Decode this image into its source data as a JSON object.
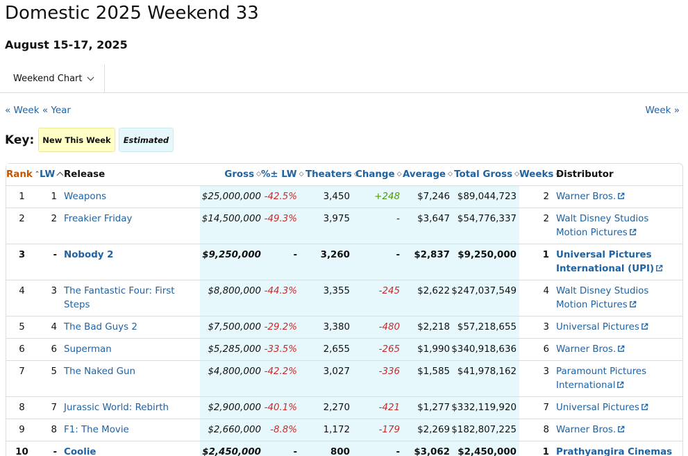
{
  "header": {
    "title": "Domestic 2025 Weekend 33",
    "subtitle": "August 15-17, 2025"
  },
  "view_select": {
    "label": "Weekend Chart"
  },
  "nav": {
    "prev_week": "« Week",
    "prev_year": "« Year",
    "next_week": "Week »"
  },
  "key": {
    "label": "Key:",
    "new_label": "New This Week",
    "estimated_label": "Estimated"
  },
  "columns": [
    "Rank",
    "LW",
    "Release",
    "Gross",
    "%± LW",
    "Theaters",
    "Change",
    "Average",
    "Total Gross",
    "Weeks",
    "Distributor"
  ],
  "rows": [
    {
      "rank": "1",
      "lw": "1",
      "release": "Weapons",
      "gross": "$25,000,000",
      "pct": "-42.5%",
      "theaters": "3,450",
      "change": "+248",
      "average": "$7,246",
      "total": "$89,044,723",
      "weeks": "2",
      "distributor": "Warner Bros.",
      "new": false
    },
    {
      "rank": "2",
      "lw": "2",
      "release": "Freakier Friday",
      "gross": "$14,500,000",
      "pct": "-49.3%",
      "theaters": "3,975",
      "change": "-",
      "average": "$3,647",
      "total": "$54,776,337",
      "weeks": "2",
      "distributor": "Walt Disney Studios Motion Pictures",
      "new": false
    },
    {
      "rank": "3",
      "lw": "-",
      "release": "Nobody 2",
      "gross": "$9,250,000",
      "pct": "-",
      "theaters": "3,260",
      "change": "-",
      "average": "$2,837",
      "total": "$9,250,000",
      "weeks": "1",
      "distributor": "Universal Pictures International (UPI)",
      "new": true
    },
    {
      "rank": "4",
      "lw": "3",
      "release": "The Fantastic Four: First Steps",
      "gross": "$8,800,000",
      "pct": "-44.3%",
      "theaters": "3,355",
      "change": "-245",
      "average": "$2,622",
      "total": "$247,037,549",
      "weeks": "4",
      "distributor": "Walt Disney Studios Motion Pictures",
      "new": false
    },
    {
      "rank": "5",
      "lw": "4",
      "release": "The Bad Guys 2",
      "gross": "$7,500,000",
      "pct": "-29.2%",
      "theaters": "3,380",
      "change": "-480",
      "average": "$2,218",
      "total": "$57,218,655",
      "weeks": "3",
      "distributor": "Universal Pictures",
      "new": false
    },
    {
      "rank": "6",
      "lw": "6",
      "release": "Superman",
      "gross": "$5,285,000",
      "pct": "-33.5%",
      "theaters": "2,655",
      "change": "-265",
      "average": "$1,990",
      "total": "$340,918,636",
      "weeks": "6",
      "distributor": "Warner Bros.",
      "new": false
    },
    {
      "rank": "7",
      "lw": "5",
      "release": "The Naked Gun",
      "gross": "$4,800,000",
      "pct": "-42.2%",
      "theaters": "3,027",
      "change": "-336",
      "average": "$1,585",
      "total": "$41,978,162",
      "weeks": "3",
      "distributor": "Paramount Pictures International",
      "new": false
    },
    {
      "rank": "8",
      "lw": "7",
      "release": "Jurassic World: Rebirth",
      "gross": "$2,900,000",
      "pct": "-40.1%",
      "theaters": "2,270",
      "change": "-421",
      "average": "$1,277",
      "total": "$332,119,920",
      "weeks": "7",
      "distributor": "Universal Pictures",
      "new": false
    },
    {
      "rank": "9",
      "lw": "8",
      "release": "F1: The Movie",
      "gross": "$2,660,000",
      "pct": "-8.8%",
      "theaters": "1,172",
      "change": "-179",
      "average": "$2,269",
      "total": "$182,807,225",
      "weeks": "8",
      "distributor": "Warner Bros.",
      "new": false
    },
    {
      "rank": "10",
      "lw": "-",
      "release": "Coolie",
      "gross": "$2,450,000",
      "pct": "-",
      "theaters": "800",
      "change": "-",
      "average": "$3,062",
      "total": "$2,450,000",
      "weeks": "1",
      "distributor": "Prathyangira Cinemas",
      "new": true
    }
  ],
  "colors": {
    "link": "#2162a1",
    "rank_header": "#c45500",
    "negative": "#c92a2a",
    "positive": "#4e9a06",
    "highlight_col": "#e7f8fc",
    "new_key": "#ffffc6"
  }
}
